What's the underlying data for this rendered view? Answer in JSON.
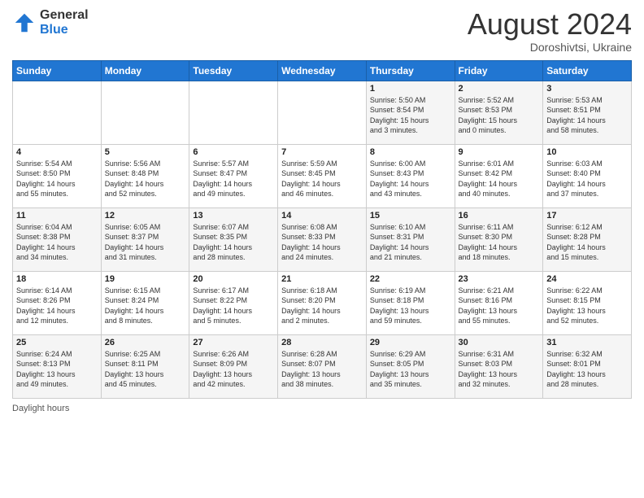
{
  "logo": {
    "general": "General",
    "blue": "Blue"
  },
  "header": {
    "month": "August 2024",
    "location": "Doroshivtsi, Ukraine"
  },
  "days_of_week": [
    "Sunday",
    "Monday",
    "Tuesday",
    "Wednesday",
    "Thursday",
    "Friday",
    "Saturday"
  ],
  "weeks": [
    [
      {
        "day": "",
        "info": ""
      },
      {
        "day": "",
        "info": ""
      },
      {
        "day": "",
        "info": ""
      },
      {
        "day": "",
        "info": ""
      },
      {
        "day": "1",
        "info": "Sunrise: 5:50 AM\nSunset: 8:54 PM\nDaylight: 15 hours\nand 3 minutes."
      },
      {
        "day": "2",
        "info": "Sunrise: 5:52 AM\nSunset: 8:53 PM\nDaylight: 15 hours\nand 0 minutes."
      },
      {
        "day": "3",
        "info": "Sunrise: 5:53 AM\nSunset: 8:51 PM\nDaylight: 14 hours\nand 58 minutes."
      }
    ],
    [
      {
        "day": "4",
        "info": "Sunrise: 5:54 AM\nSunset: 8:50 PM\nDaylight: 14 hours\nand 55 minutes."
      },
      {
        "day": "5",
        "info": "Sunrise: 5:56 AM\nSunset: 8:48 PM\nDaylight: 14 hours\nand 52 minutes."
      },
      {
        "day": "6",
        "info": "Sunrise: 5:57 AM\nSunset: 8:47 PM\nDaylight: 14 hours\nand 49 minutes."
      },
      {
        "day": "7",
        "info": "Sunrise: 5:59 AM\nSunset: 8:45 PM\nDaylight: 14 hours\nand 46 minutes."
      },
      {
        "day": "8",
        "info": "Sunrise: 6:00 AM\nSunset: 8:43 PM\nDaylight: 14 hours\nand 43 minutes."
      },
      {
        "day": "9",
        "info": "Sunrise: 6:01 AM\nSunset: 8:42 PM\nDaylight: 14 hours\nand 40 minutes."
      },
      {
        "day": "10",
        "info": "Sunrise: 6:03 AM\nSunset: 8:40 PM\nDaylight: 14 hours\nand 37 minutes."
      }
    ],
    [
      {
        "day": "11",
        "info": "Sunrise: 6:04 AM\nSunset: 8:38 PM\nDaylight: 14 hours\nand 34 minutes."
      },
      {
        "day": "12",
        "info": "Sunrise: 6:05 AM\nSunset: 8:37 PM\nDaylight: 14 hours\nand 31 minutes."
      },
      {
        "day": "13",
        "info": "Sunrise: 6:07 AM\nSunset: 8:35 PM\nDaylight: 14 hours\nand 28 minutes."
      },
      {
        "day": "14",
        "info": "Sunrise: 6:08 AM\nSunset: 8:33 PM\nDaylight: 14 hours\nand 24 minutes."
      },
      {
        "day": "15",
        "info": "Sunrise: 6:10 AM\nSunset: 8:31 PM\nDaylight: 14 hours\nand 21 minutes."
      },
      {
        "day": "16",
        "info": "Sunrise: 6:11 AM\nSunset: 8:30 PM\nDaylight: 14 hours\nand 18 minutes."
      },
      {
        "day": "17",
        "info": "Sunrise: 6:12 AM\nSunset: 8:28 PM\nDaylight: 14 hours\nand 15 minutes."
      }
    ],
    [
      {
        "day": "18",
        "info": "Sunrise: 6:14 AM\nSunset: 8:26 PM\nDaylight: 14 hours\nand 12 minutes."
      },
      {
        "day": "19",
        "info": "Sunrise: 6:15 AM\nSunset: 8:24 PM\nDaylight: 14 hours\nand 8 minutes."
      },
      {
        "day": "20",
        "info": "Sunrise: 6:17 AM\nSunset: 8:22 PM\nDaylight: 14 hours\nand 5 minutes."
      },
      {
        "day": "21",
        "info": "Sunrise: 6:18 AM\nSunset: 8:20 PM\nDaylight: 14 hours\nand 2 minutes."
      },
      {
        "day": "22",
        "info": "Sunrise: 6:19 AM\nSunset: 8:18 PM\nDaylight: 13 hours\nand 59 minutes."
      },
      {
        "day": "23",
        "info": "Sunrise: 6:21 AM\nSunset: 8:16 PM\nDaylight: 13 hours\nand 55 minutes."
      },
      {
        "day": "24",
        "info": "Sunrise: 6:22 AM\nSunset: 8:15 PM\nDaylight: 13 hours\nand 52 minutes."
      }
    ],
    [
      {
        "day": "25",
        "info": "Sunrise: 6:24 AM\nSunset: 8:13 PM\nDaylight: 13 hours\nand 49 minutes."
      },
      {
        "day": "26",
        "info": "Sunrise: 6:25 AM\nSunset: 8:11 PM\nDaylight: 13 hours\nand 45 minutes."
      },
      {
        "day": "27",
        "info": "Sunrise: 6:26 AM\nSunset: 8:09 PM\nDaylight: 13 hours\nand 42 minutes."
      },
      {
        "day": "28",
        "info": "Sunrise: 6:28 AM\nSunset: 8:07 PM\nDaylight: 13 hours\nand 38 minutes."
      },
      {
        "day": "29",
        "info": "Sunrise: 6:29 AM\nSunset: 8:05 PM\nDaylight: 13 hours\nand 35 minutes."
      },
      {
        "day": "30",
        "info": "Sunrise: 6:31 AM\nSunset: 8:03 PM\nDaylight: 13 hours\nand 32 minutes."
      },
      {
        "day": "31",
        "info": "Sunrise: 6:32 AM\nSunset: 8:01 PM\nDaylight: 13 hours\nand 28 minutes."
      }
    ]
  ],
  "footer": {
    "daylight_label": "Daylight hours"
  }
}
